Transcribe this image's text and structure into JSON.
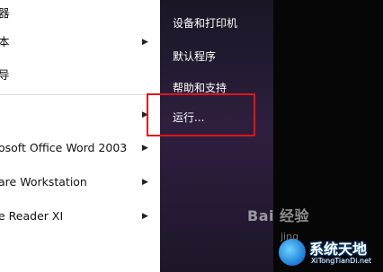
{
  "programs": [
    {
      "label": "器",
      "arrow": false
    },
    {
      "label": "本",
      "arrow": true
    },
    {
      "label": "导",
      "arrow": false
    },
    {
      "label": "",
      "arrow": true
    },
    {
      "label": "osoft Office Word 2003",
      "arrow": true
    },
    {
      "label": "are Workstation",
      "arrow": true
    },
    {
      "label": "e Reader XI",
      "arrow": true
    },
    {
      "label": "",
      "arrow": false
    }
  ],
  "right_menu": {
    "devices": "设备和打印机",
    "default_programs": "默认程序",
    "help": "帮助和支持",
    "run": "运行..."
  },
  "watermark": {
    "baidu": "Bai 经验",
    "baidu_sub": "jing",
    "site_title": "系统天地",
    "site_url": "XiTongTianDi.net"
  },
  "colors": {
    "highlight": "#e0141c",
    "right_pane": "#2a1c3a"
  }
}
